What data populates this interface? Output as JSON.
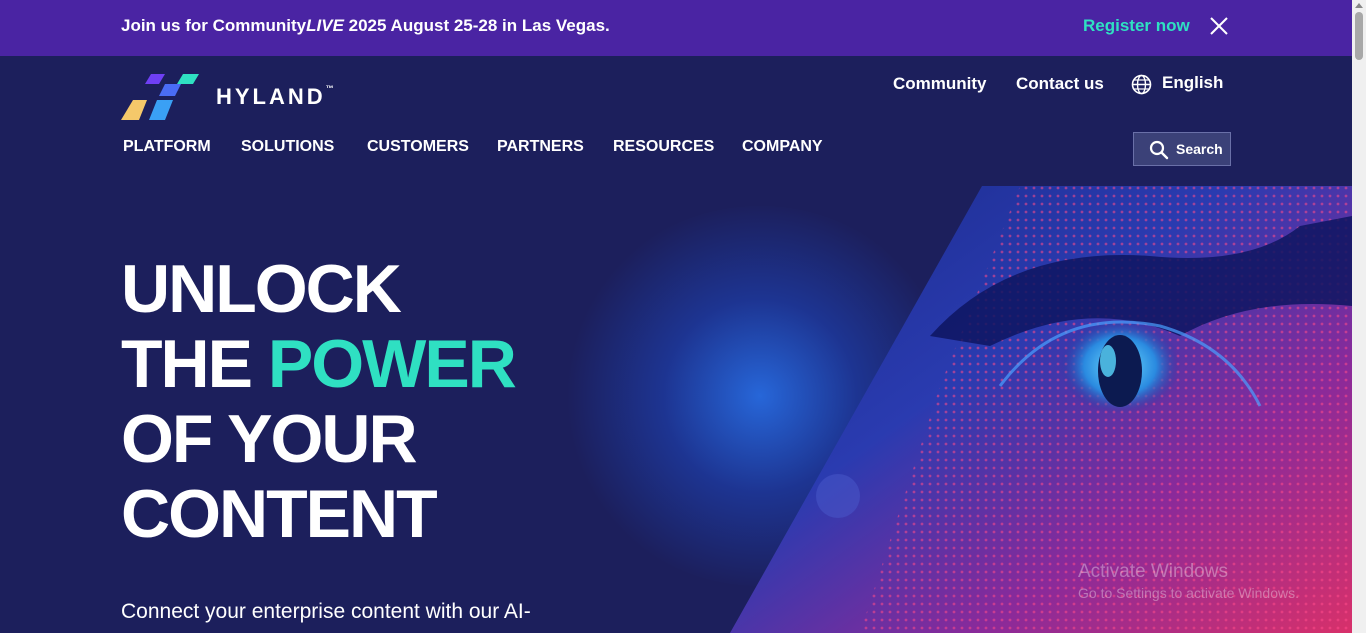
{
  "banner": {
    "text_prefix": "Join us for Community",
    "text_live": "LIVE",
    "text_suffix": " 2025 August 25-28 in Las Vegas.",
    "register_label": "Register now",
    "close_icon": "close-icon"
  },
  "header": {
    "logo_text": "HYLAND",
    "logo_tm": "™",
    "utility": {
      "community": "Community",
      "contact": "Contact us",
      "language": "English",
      "language_icon": "globe-icon"
    },
    "nav": [
      "PLATFORM",
      "SOLUTIONS",
      "CUSTOMERS",
      "PARTNERS",
      "RESOURCES",
      "COMPANY"
    ],
    "search_label": "Search",
    "search_icon": "search-icon"
  },
  "hero": {
    "title_line1": "UNLOCK",
    "title_line2_plain": "THE ",
    "title_line2_accent": "POWER",
    "title_line3": "OF YOUR",
    "title_line4": "CONTENT",
    "subtitle": "Connect your enterprise content with our AI-"
  },
  "watermark": {
    "title": "Activate Windows",
    "subtitle": "Go to Settings to activate Windows."
  },
  "colors": {
    "banner_bg": "#4a24a3",
    "header_bg": "#1c1f5c",
    "accent": "#2fe0c2",
    "text": "#ffffff"
  }
}
